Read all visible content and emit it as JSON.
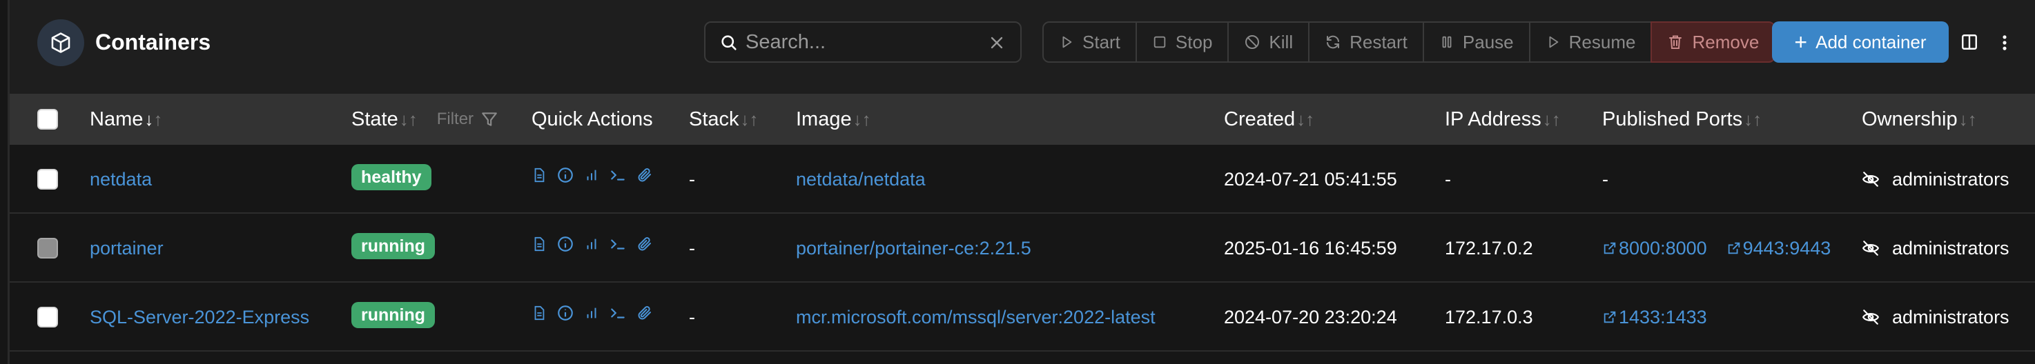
{
  "header": {
    "title": "Containers"
  },
  "search": {
    "placeholder": "Search..."
  },
  "actions": {
    "start": "Start",
    "stop": "Stop",
    "kill": "Kill",
    "restart": "Restart",
    "pause": "Pause",
    "resume": "Resume",
    "remove": "Remove",
    "add": "Add container"
  },
  "columns": {
    "name": "Name",
    "state": "State",
    "state_filter": "Filter",
    "quick_actions": "Quick Actions",
    "stack": "Stack",
    "image": "Image",
    "created": "Created",
    "ip": "IP Address",
    "ports": "Published Ports",
    "ownership": "Ownership"
  },
  "rows": [
    {
      "name": "netdata",
      "state": "healthy",
      "stack": "-",
      "image": "netdata/netdata",
      "created": "2024-07-21 05:41:55",
      "ip": "-",
      "ports": [
        "-"
      ],
      "ownership": "administrators",
      "selected_style": "white"
    },
    {
      "name": "portainer",
      "state": "running",
      "stack": "-",
      "image": "portainer/portainer-ce:2.21.5",
      "created": "2025-01-16 16:45:59",
      "ip": "172.17.0.2",
      "ports": [
        "8000:8000",
        "9443:9443"
      ],
      "ownership": "administrators",
      "selected_style": "disabled"
    },
    {
      "name": "SQL-Server-2022-Express",
      "state": "running",
      "stack": "-",
      "image": "mcr.microsoft.com/mssql/server:2022-latest",
      "created": "2024-07-20 23:20:24",
      "ip": "172.17.0.3",
      "ports": [
        "1433:1433"
      ],
      "ownership": "administrators",
      "selected_style": "white"
    }
  ],
  "colors": {
    "accent": "#3b86c8",
    "link": "#4a94d8",
    "badge_green": "#3fa66b",
    "remove_bg": "#4a2222",
    "header_row": "#333333",
    "background": "#161616"
  }
}
